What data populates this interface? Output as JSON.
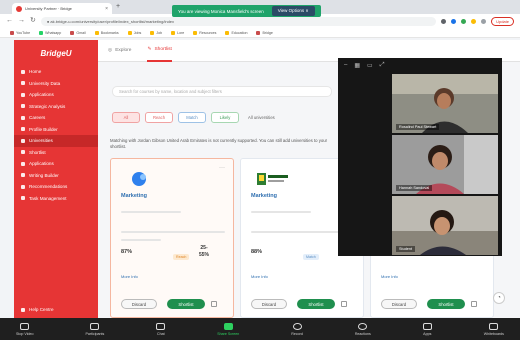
{
  "browser": {
    "tab_title": "University Partner · Bridge",
    "url": "● ak.bridge-u.com/university/user/profile/index_shortlist/marketing/index",
    "share_banner": "You are viewing Monica Mansfield's screen",
    "view_options": "View Options ∨",
    "update": "Update",
    "bookmarks": [
      "YouTube",
      "Whatsapp",
      "Gmail",
      "Bookmarks",
      "Jobs",
      "Job",
      "Lore",
      "Resources",
      "Education",
      "Bridge"
    ]
  },
  "sidebar": {
    "brand": "BridgeU",
    "items": [
      {
        "label": "Home"
      },
      {
        "label": "University Data"
      },
      {
        "label": "Applications"
      },
      {
        "label": "Strategic Analysis"
      },
      {
        "label": "Careers"
      },
      {
        "label": "Profile Builder"
      },
      {
        "label": "Universities",
        "active": true
      },
      {
        "label": "Shortlist"
      },
      {
        "label": "Applications"
      },
      {
        "label": "Writing Builder"
      },
      {
        "label": "Recommendations"
      },
      {
        "label": "Task Management"
      }
    ],
    "help": "Help Centre"
  },
  "main": {
    "tabs": [
      {
        "label": "Explore",
        "active": false
      },
      {
        "label": "Shortlist",
        "active": true
      }
    ],
    "search_placeholder": "Search for courses by name, location and subject filters",
    "filters": [
      {
        "label": "All",
        "style": "on"
      },
      {
        "label": "Reach",
        "style": ""
      },
      {
        "label": "Match",
        "style": "blue"
      },
      {
        "label": "Likely",
        "style": "green"
      }
    ],
    "filter_count": "All universities",
    "notice": "Matching with Jordan Gibson United Arab Emirates is not currently supported. You can still add universities to your shortlist.",
    "cards": [
      {
        "name": "Marketing",
        "pct": "87%",
        "pct2": "25-\n55%",
        "tag": "Reach",
        "more": "More Info",
        "discard": "Discard",
        "shortlist": "Shortlist"
      },
      {
        "name": "Marketing",
        "pct": "88%",
        "pct2": "",
        "tag": "Match",
        "more": "More Info",
        "discard": "Discard",
        "shortlist": "Shortlist"
      },
      {
        "name": "",
        "pct": "",
        "pct2": "",
        "tag": "",
        "more": "More Info",
        "discard": "Discard",
        "shortlist": "Shortlist"
      }
    ]
  },
  "zoom": {
    "participants": [
      {
        "name": "Rosalind Paul Stewart"
      },
      {
        "name": "Hannah Sandoval"
      },
      {
        "name": "Student"
      }
    ],
    "controls": [
      "Stop Video",
      "Participants",
      "Chat",
      "Share Screen",
      "Record",
      "Reactions",
      "Apps",
      "Whiteboards"
    ],
    "active_control": "Share Screen"
  }
}
